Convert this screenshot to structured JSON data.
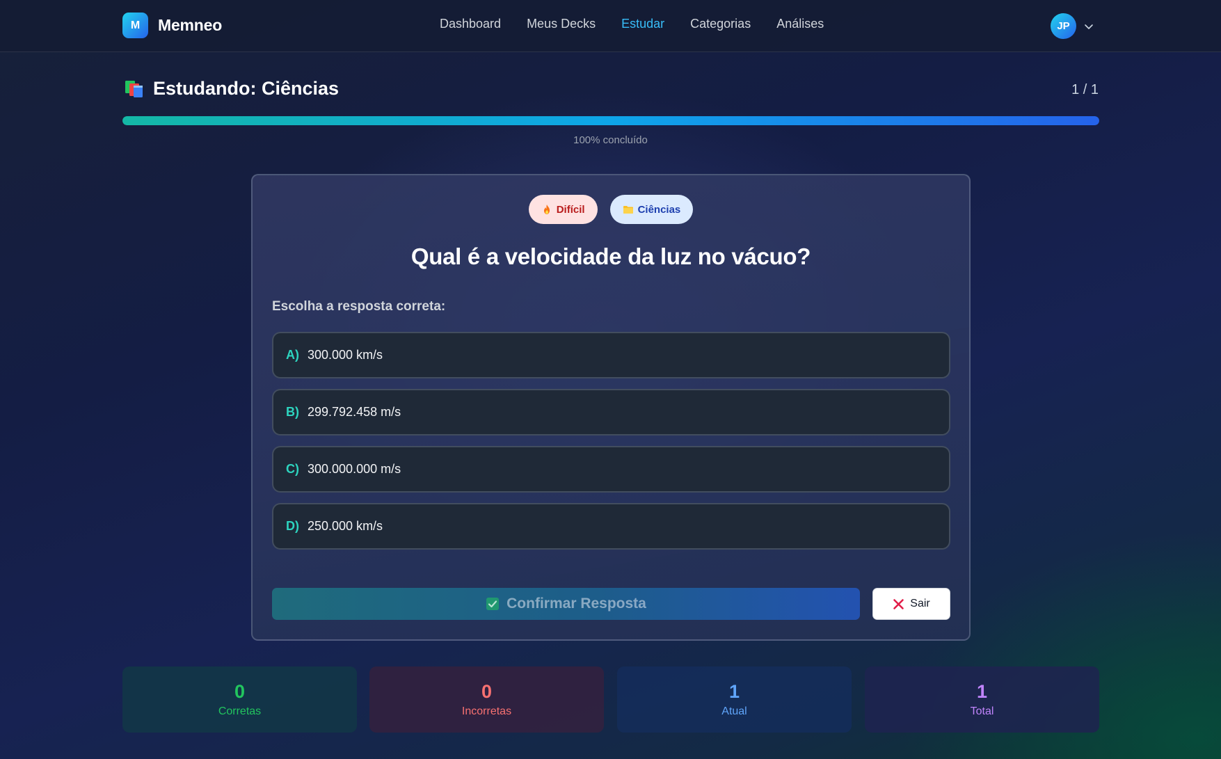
{
  "app": {
    "logo_letter": "M",
    "name": "Memneo"
  },
  "nav": {
    "items": [
      {
        "label": "Dashboard",
        "active": false
      },
      {
        "label": "Meus Decks",
        "active": false
      },
      {
        "label": "Estudar",
        "active": true
      },
      {
        "label": "Categorias",
        "active": false
      },
      {
        "label": "Análises",
        "active": false
      }
    ]
  },
  "user": {
    "initials": "JP",
    "menu_icon": "chevron-down-icon"
  },
  "study": {
    "icon": "books-icon",
    "title": "Estudando: Ciências",
    "counter": "1 / 1",
    "progress_percent": 100,
    "progress_label": "100% concluído"
  },
  "card": {
    "tags": [
      {
        "icon": "fire-icon",
        "label": "Difícil"
      },
      {
        "icon": "folder-icon",
        "label": "Ciências"
      }
    ],
    "question": "Qual é a velocidade da luz no vácuo?",
    "instruction": "Escolha a resposta correta:",
    "options": [
      {
        "letter": "A)",
        "text": "300.000 km/s"
      },
      {
        "letter": "B)",
        "text": "299.792.458 m/s"
      },
      {
        "letter": "C)",
        "text": "300.000.000 m/s"
      },
      {
        "letter": "D)",
        "text": "250.000 km/s"
      }
    ],
    "confirm_label": "Confirmar Resposta",
    "exit_label": "Sair"
  },
  "stats": {
    "correct": {
      "value": "0",
      "label": "Corretas"
    },
    "wrong": {
      "value": "0",
      "label": "Incorretas"
    },
    "current": {
      "value": "1",
      "label": "Atual"
    },
    "total": {
      "value": "1",
      "label": "Total"
    }
  },
  "colors": {
    "accent": "#38bdf8",
    "option_letter": "#2dd4bf",
    "correct": "#22c55e",
    "wrong": "#f87171",
    "current": "#60a5fa",
    "total": "#c084fc"
  }
}
